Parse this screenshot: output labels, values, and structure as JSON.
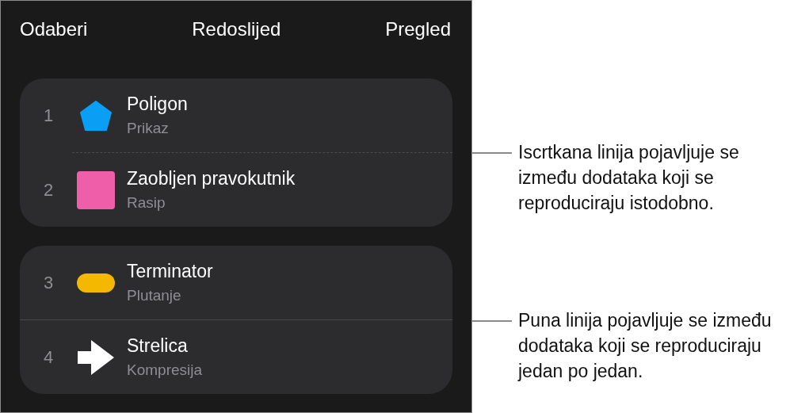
{
  "nav": {
    "left": "Odaberi",
    "title": "Redoslijed",
    "right": "Pregled"
  },
  "groups": [
    {
      "dashed_separator": true,
      "items": [
        {
          "number": "1",
          "title": "Poligon",
          "subtitle": "Prikaz",
          "kind": "pentagon",
          "color": "#0a9ff5"
        },
        {
          "number": "2",
          "title": "Zaobljen pravokutnik",
          "subtitle": "Rasip",
          "kind": "square",
          "color": "#ef5ea8"
        }
      ]
    },
    {
      "dashed_separator": false,
      "items": [
        {
          "number": "3",
          "title": "Terminator",
          "subtitle": "Plutanje",
          "kind": "pill",
          "color": "#f5b800"
        },
        {
          "number": "4",
          "title": "Strelica",
          "subtitle": "Kompresija",
          "kind": "arrow",
          "color": "#ffffff"
        }
      ]
    }
  ],
  "callouts": [
    {
      "text": "Iscrtkana linija pojavljuje se između dodataka koji se reproduciraju istodobno."
    },
    {
      "text": "Puna linija pojavljuje se između dodataka koji se reproduciraju jedan po jedan."
    }
  ]
}
